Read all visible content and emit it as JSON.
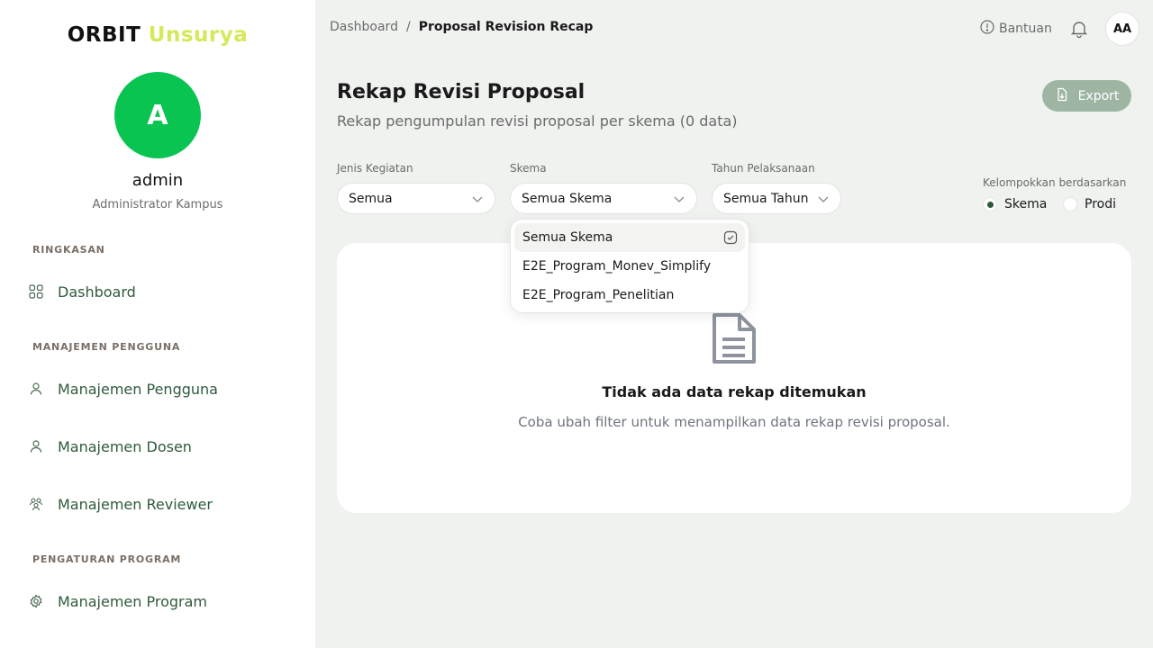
{
  "brand": {
    "part1": "ORBIT",
    "part2": "Unsurya"
  },
  "user": {
    "initial": "A",
    "name": "admin",
    "role": "Administrator Kampus"
  },
  "sidebar": {
    "sections": [
      {
        "label": "RINGKASAN"
      },
      {
        "label": "MANAJEMEN PENGGUNA"
      },
      {
        "label": "PENGATURAN PROGRAM"
      }
    ],
    "items": [
      {
        "label": "Dashboard",
        "icon": "grid-icon"
      },
      {
        "label": "Manajemen Pengguna",
        "icon": "user-icon"
      },
      {
        "label": "Manajemen Dosen",
        "icon": "user-icon"
      },
      {
        "label": "Manajemen Reviewer",
        "icon": "users-group-icon"
      },
      {
        "label": "Manajemen Program",
        "icon": "gear-icon"
      }
    ]
  },
  "topbar": {
    "breadcrumb": {
      "parent": "Dashboard",
      "separator": "/",
      "current": "Proposal Revision Recap"
    },
    "help_label": "Bantuan",
    "avatar_initials": "AA"
  },
  "header": {
    "title": "Rekap Revisi Proposal",
    "subtitle": "Rekap pengumpulan revisi proposal per skema (0 data)",
    "export_label": "Export"
  },
  "filters": {
    "jenis": {
      "label": "Jenis Kegiatan",
      "value": "Semua"
    },
    "skema": {
      "label": "Skema",
      "value": "Semua Skema"
    },
    "tahun": {
      "label": "Tahun Pelaksanaan",
      "value": "Semua Tahun"
    },
    "group": {
      "label": "Kelompokkan berdasarkan",
      "options": [
        "Skema",
        "Prodi"
      ],
      "selected": "Skema"
    }
  },
  "dropdown": {
    "options": [
      "Semua Skema",
      "E2E_Program_Monev_Simplify",
      "E2E_Program_Penelitian"
    ],
    "selected": "Semua Skema"
  },
  "empty": {
    "title": "Tidak ada data rekap ditemukan",
    "subtitle": "Coba ubah filter untuk menampilkan data rekap revisi proposal."
  },
  "colors": {
    "brand_accent": "#d7e85a",
    "avatar_green": "#0ac452",
    "nav_text": "#2f5a3c",
    "export_bg": "#9fb5a4"
  }
}
